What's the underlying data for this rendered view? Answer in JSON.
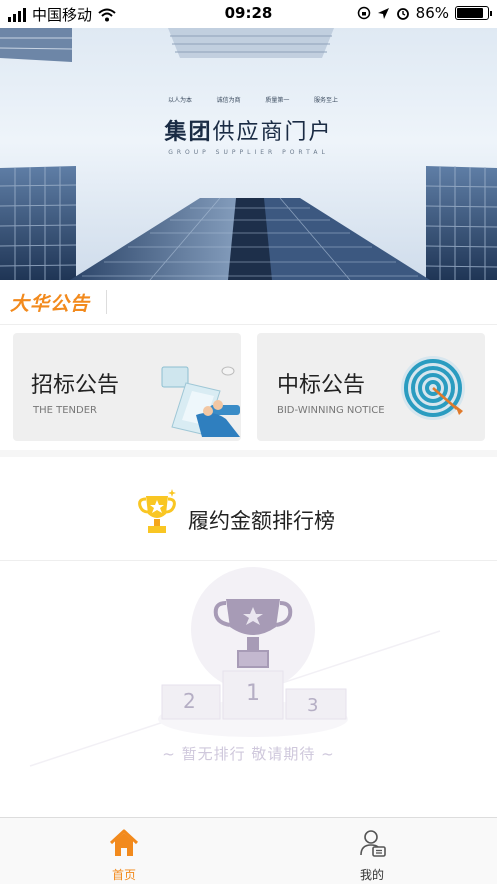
{
  "status_bar": {
    "carrier": "中国移动",
    "time": "09:28",
    "battery_percent": "86%",
    "battery_level": 0.86
  },
  "banner": {
    "title_bold": "集团",
    "title_rest": "供应商门户",
    "subtitle": "GROUP SUPPLIER PORTAL",
    "tags": [
      "以人为本",
      "诚信为商",
      "质量第一",
      "服务至上"
    ]
  },
  "notice": {
    "logo_text": "大华公告"
  },
  "cards": [
    {
      "title": "招标公告",
      "subtitle": "THE TENDER",
      "icon": "laptop-icon"
    },
    {
      "title": "中标公告",
      "subtitle": "BID-WINNING NOTICE",
      "icon": "target-icon"
    }
  ],
  "ranking": {
    "title": "履约金额排行榜",
    "empty_text": "~ 暂无排行 敬请期待 ~",
    "podium": [
      "1",
      "2",
      "3"
    ]
  },
  "tabbar": {
    "tabs": [
      {
        "label": "首页",
        "icon": "home-icon",
        "active": true
      },
      {
        "label": "我的",
        "icon": "profile-icon",
        "active": false
      }
    ]
  },
  "colors": {
    "accent": "#f28a1d",
    "text_dark": "#222222",
    "tab_inactive": "#333333"
  }
}
